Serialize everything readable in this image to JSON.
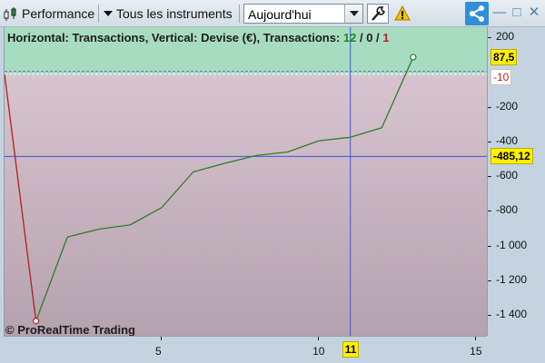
{
  "toolbar": {
    "performance_label": "Performance",
    "instruments_label": "Tous les instruments",
    "period_value": "Aujourd'hui",
    "icons": [
      "candlestick-icon",
      "caret-down-icon",
      "wrench-icon",
      "warning-icon",
      "share-icon",
      "minimize-icon",
      "maximize-icon",
      "close-icon"
    ]
  },
  "window_controls": {
    "minimize": "—",
    "maximize": "□",
    "close": "✕"
  },
  "info": {
    "text": "Horizontal: Transactions, Vertical: Devise (€), Transactions: ",
    "winners": "12",
    "separator": " / ",
    "neutral": "0",
    "losers": "1"
  },
  "watermark": "© ProRealTime Trading",
  "colors": {
    "gain_zone": "#a8dcc0",
    "loss_zone_top": "#d8c4cf",
    "loss_zone_bottom": "#b4a2ae",
    "curve_gain": "#2e7d2e",
    "curve_loss": "#b02020",
    "crosshair": "#3a55e6",
    "badge": "#fef000"
  },
  "readouts": {
    "last_value": "87,5",
    "zero_label": "-10",
    "crosshair_value": "-485,12",
    "crosshair_x": "11"
  },
  "chart_data": {
    "type": "line",
    "x": [
      1,
      2,
      3,
      4,
      5,
      6,
      7,
      8,
      9,
      10,
      11,
      12,
      13
    ],
    "series": [
      {
        "values": [
          -10,
          -1435,
          -950,
          -905,
          -880,
          -780,
          -575,
          -525,
          -480,
          -460,
          -395,
          -375,
          -320,
          87.5
        ]
      }
    ],
    "x_points": [
      0,
      1,
      2,
      3,
      4,
      5,
      6,
      7,
      8,
      9,
      10,
      11,
      12,
      13
    ],
    "x_ticks": [
      "5",
      "10",
      "15"
    ],
    "y_ticks": [
      "200",
      "-200",
      "-400",
      "-600",
      "-800",
      "-1 000",
      "-1 200",
      "-1 400"
    ],
    "y_tick_values": [
      200,
      -200,
      -400,
      -600,
      -800,
      -1000,
      -1200,
      -1400
    ],
    "x_tick_values": [
      5,
      10,
      15
    ],
    "xlim": [
      0,
      15.4
    ],
    "ylim": [
      -1520,
      260
    ],
    "crosshair": {
      "x": 11,
      "y": -485.12
    },
    "baseline": -10,
    "grid": false
  }
}
